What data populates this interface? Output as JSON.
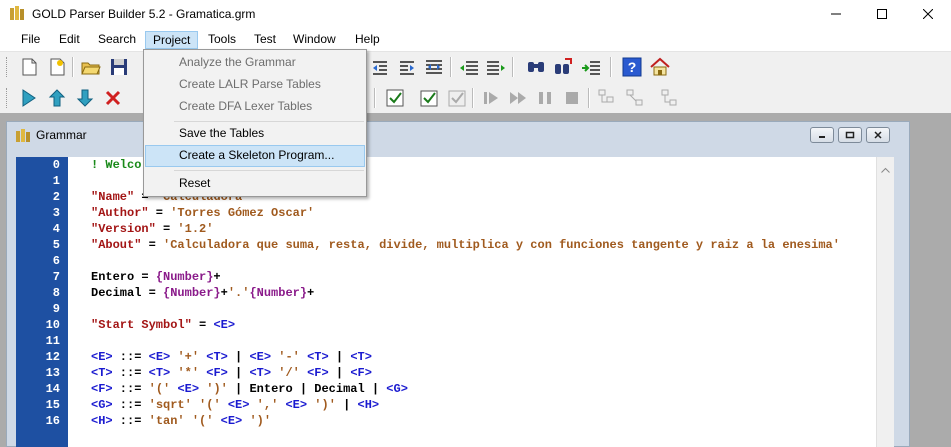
{
  "window": {
    "title": "GOLD Parser Builder 5.2 - Gramatica.grm"
  },
  "menubar": {
    "items": [
      "File",
      "Edit",
      "Search",
      "Project",
      "Tools",
      "Test",
      "Window",
      "Help"
    ]
  },
  "project_menu": {
    "items": [
      {
        "label": "Analyze the Grammar",
        "enabled": false
      },
      {
        "label": "Create LALR Parse Tables",
        "enabled": false
      },
      {
        "label": "Create DFA Lexer Tables",
        "enabled": false
      },
      {
        "label": "Save the Tables",
        "enabled": true
      },
      {
        "label": "Create a Skeleton Program...",
        "enabled": true,
        "highlighted": true
      },
      {
        "label": "Reset",
        "enabled": true
      }
    ]
  },
  "grammar_window": {
    "title": "Grammar"
  },
  "editor": {
    "line_numbers": [
      "0",
      "1",
      "2",
      "3",
      "4",
      "5",
      "6",
      "7",
      "8",
      "9",
      "10",
      "11",
      "12",
      "13",
      "14",
      "15",
      "16"
    ],
    "lines": [
      [
        [
          "! Welco",
          "comment"
        ]
      ],
      [],
      [
        [
          "\"Name\"",
          "string"
        ],
        [
          " = ",
          "plain"
        ],
        [
          "'Calculadora'",
          "literal"
        ]
      ],
      [
        [
          "\"Author\"",
          "string"
        ],
        [
          " = ",
          "plain"
        ],
        [
          "'Torres Gómez Oscar'",
          "literal"
        ]
      ],
      [
        [
          "\"Version\"",
          "string"
        ],
        [
          " = ",
          "plain"
        ],
        [
          "'1.2'",
          "literal"
        ]
      ],
      [
        [
          "\"About\"",
          "string"
        ],
        [
          " = ",
          "plain"
        ],
        [
          "'Calculadora que suma, resta, divide, multiplica y con funciones tangente y raiz a la enesima'",
          "literal"
        ]
      ],
      [],
      [
        [
          "Entero = ",
          "plain"
        ],
        [
          "{Number}",
          "set"
        ],
        [
          "+",
          "plain"
        ]
      ],
      [
        [
          "Decimal = ",
          "plain"
        ],
        [
          "{Number}",
          "set"
        ],
        [
          "+",
          "plain"
        ],
        [
          "'.'",
          "literal"
        ],
        [
          "{Number}",
          "set"
        ],
        [
          "+",
          "plain"
        ]
      ],
      [],
      [
        [
          "\"Start Symbol\"",
          "string"
        ],
        [
          " = ",
          "plain"
        ],
        [
          "<E>",
          "nonterm"
        ]
      ],
      [],
      [
        [
          "<E>",
          "nonterm"
        ],
        [
          " ::= ",
          "plain"
        ],
        [
          "<E>",
          "nonterm"
        ],
        [
          " ",
          "plain"
        ],
        [
          "'+'",
          "literal"
        ],
        [
          " ",
          "plain"
        ],
        [
          "<T>",
          "nonterm"
        ],
        [
          " | ",
          "plain"
        ],
        [
          "<E>",
          "nonterm"
        ],
        [
          " ",
          "plain"
        ],
        [
          "'-'",
          "literal"
        ],
        [
          " ",
          "plain"
        ],
        [
          "<T>",
          "nonterm"
        ],
        [
          " | ",
          "plain"
        ],
        [
          "<T>",
          "nonterm"
        ]
      ],
      [
        [
          "<T>",
          "nonterm"
        ],
        [
          " ::= ",
          "plain"
        ],
        [
          "<T>",
          "nonterm"
        ],
        [
          " ",
          "plain"
        ],
        [
          "'*'",
          "literal"
        ],
        [
          " ",
          "plain"
        ],
        [
          "<F>",
          "nonterm"
        ],
        [
          " | ",
          "plain"
        ],
        [
          "<T>",
          "nonterm"
        ],
        [
          " ",
          "plain"
        ],
        [
          "'/'",
          "literal"
        ],
        [
          " ",
          "plain"
        ],
        [
          "<F>",
          "nonterm"
        ],
        [
          " | ",
          "plain"
        ],
        [
          "<F>",
          "nonterm"
        ]
      ],
      [
        [
          "<F>",
          "nonterm"
        ],
        [
          " ::= ",
          "plain"
        ],
        [
          "'('",
          "literal"
        ],
        [
          " ",
          "plain"
        ],
        [
          "<E>",
          "nonterm"
        ],
        [
          " ",
          "plain"
        ],
        [
          "')'",
          "literal"
        ],
        [
          " | Entero | Decimal | ",
          "plain"
        ],
        [
          "<G>",
          "nonterm"
        ]
      ],
      [
        [
          "<G>",
          "nonterm"
        ],
        [
          " ::= ",
          "plain"
        ],
        [
          "'sqrt'",
          "literal"
        ],
        [
          " ",
          "plain"
        ],
        [
          "'('",
          "literal"
        ],
        [
          " ",
          "plain"
        ],
        [
          "<E>",
          "nonterm"
        ],
        [
          " ",
          "plain"
        ],
        [
          "','",
          "literal"
        ],
        [
          " ",
          "plain"
        ],
        [
          "<E>",
          "nonterm"
        ],
        [
          " ",
          "plain"
        ],
        [
          "')'",
          "literal"
        ],
        [
          " | ",
          "plain"
        ],
        [
          "<H>",
          "nonterm"
        ]
      ],
      [
        [
          "<H>",
          "nonterm"
        ],
        [
          " ::= ",
          "plain"
        ],
        [
          "'tan'",
          "literal"
        ],
        [
          " ",
          "plain"
        ],
        [
          "'('",
          "literal"
        ],
        [
          " ",
          "plain"
        ],
        [
          "<E>",
          "nonterm"
        ],
        [
          " ",
          "plain"
        ],
        [
          "')'",
          "literal"
        ]
      ]
    ]
  },
  "colors": {
    "comment": "#1a8a1a",
    "string": "#a31515",
    "literal": "#a05a1e",
    "set": "#8a1a8a",
    "nonterm": "#1a1ad0",
    "plain": "#000000",
    "gutter": "#1e50a2"
  }
}
